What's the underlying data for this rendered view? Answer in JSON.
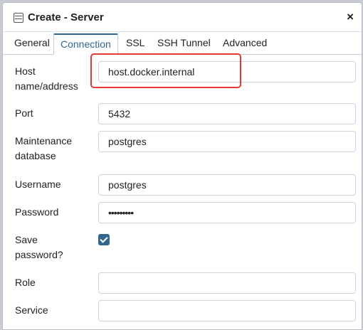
{
  "dialog": {
    "title": "Create - Server",
    "title_icon": "server-icon",
    "close_label": "×"
  },
  "tabs": [
    {
      "label": "General",
      "active": false
    },
    {
      "label": "Connection",
      "active": true
    },
    {
      "label": "SSL",
      "active": false
    },
    {
      "label": "SSH Tunnel",
      "active": false
    },
    {
      "label": "Advanced",
      "active": false
    }
  ],
  "form": {
    "host": {
      "label_line1": "Host",
      "label_line2": "name/address",
      "value": "host.docker.internal"
    },
    "port": {
      "label": "Port",
      "value": "5432"
    },
    "maintenance_db": {
      "label_line1": "Maintenance",
      "label_line2": "database",
      "value": "postgres"
    },
    "username": {
      "label": "Username",
      "value": "postgres"
    },
    "password": {
      "label": "Password",
      "value": "•••••••••"
    },
    "save_password": {
      "label_line1": "Save",
      "label_line2": "password?",
      "checked": true
    },
    "role": {
      "label": "Role",
      "value": ""
    },
    "service": {
      "label": "Service",
      "value": ""
    }
  },
  "colors": {
    "accent": "#326690",
    "highlight": "#e53935"
  }
}
